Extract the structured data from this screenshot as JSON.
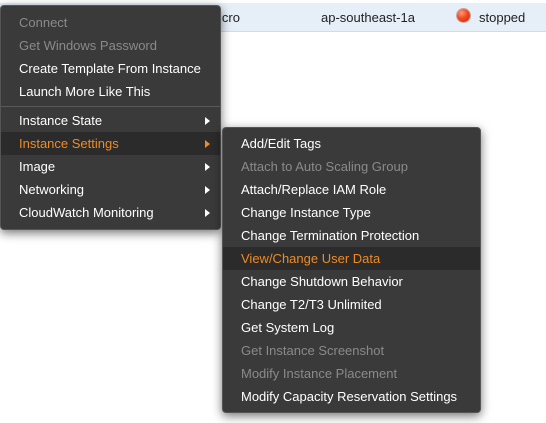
{
  "instance_row": {
    "type": "icro",
    "az": "ap-southeast-1a",
    "status": "stopped",
    "status_color": "#f04a22"
  },
  "context_menu": {
    "items": [
      {
        "label": "Connect",
        "enabled": false
      },
      {
        "label": "Get Windows Password",
        "enabled": false
      },
      {
        "label": "Create Template From Instance",
        "enabled": true
      },
      {
        "label": "Launch More Like This",
        "enabled": true
      },
      {
        "label": "Instance State",
        "enabled": true,
        "submenu": true
      },
      {
        "label": "Instance Settings",
        "enabled": true,
        "submenu": true,
        "active": true
      },
      {
        "label": "Image",
        "enabled": true,
        "submenu": true
      },
      {
        "label": "Networking",
        "enabled": true,
        "submenu": true
      },
      {
        "label": "CloudWatch Monitoring",
        "enabled": true,
        "submenu": true
      }
    ]
  },
  "instance_settings_submenu": {
    "items": [
      {
        "label": "Add/Edit Tags",
        "enabled": true
      },
      {
        "label": "Attach to Auto Scaling Group",
        "enabled": false
      },
      {
        "label": "Attach/Replace IAM Role",
        "enabled": true
      },
      {
        "label": "Change Instance Type",
        "enabled": true
      },
      {
        "label": "Change Termination Protection",
        "enabled": true
      },
      {
        "label": "View/Change User Data",
        "enabled": true,
        "active": true
      },
      {
        "label": "Change Shutdown Behavior",
        "enabled": true
      },
      {
        "label": "Change T2/T3 Unlimited",
        "enabled": true
      },
      {
        "label": "Get System Log",
        "enabled": true
      },
      {
        "label": "Get Instance Screenshot",
        "enabled": false
      },
      {
        "label": "Modify Instance Placement",
        "enabled": false
      },
      {
        "label": "Modify Capacity Reservation Settings",
        "enabled": true
      }
    ]
  },
  "colors": {
    "menu_bg": "#3a3a3a",
    "active_text": "#f08a24",
    "disabled_text": "#8a8a8a"
  }
}
